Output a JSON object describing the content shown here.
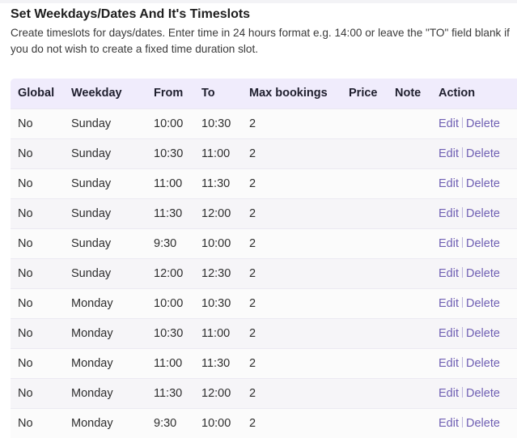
{
  "header": {
    "title": "Set Weekdays/Dates And It's Timeslots",
    "description": "Create timeslots for days/dates. Enter time in 24 hours format e.g. 14:00 or leave the \"TO\" field blank if you do not wish to create a fixed time duration slot."
  },
  "table": {
    "columns": [
      "Global",
      "Weekday",
      "From",
      "To",
      "Max bookings",
      "Price",
      "Note",
      "Action"
    ],
    "edit_label": "Edit",
    "delete_label": "Delete",
    "rows": [
      {
        "global": "No",
        "weekday": "Sunday",
        "from": "10:00",
        "to": "10:30",
        "max": "2",
        "price": "",
        "note": ""
      },
      {
        "global": "No",
        "weekday": "Sunday",
        "from": "10:30",
        "to": "11:00",
        "max": "2",
        "price": "",
        "note": ""
      },
      {
        "global": "No",
        "weekday": "Sunday",
        "from": "11:00",
        "to": "11:30",
        "max": "2",
        "price": "",
        "note": ""
      },
      {
        "global": "No",
        "weekday": "Sunday",
        "from": "11:30",
        "to": "12:00",
        "max": "2",
        "price": "",
        "note": ""
      },
      {
        "global": "No",
        "weekday": "Sunday",
        "from": "9:30",
        "to": "10:00",
        "max": "2",
        "price": "",
        "note": ""
      },
      {
        "global": "No",
        "weekday": "Sunday",
        "from": "12:00",
        "to": "12:30",
        "max": "2",
        "price": "",
        "note": ""
      },
      {
        "global": "No",
        "weekday": "Monday",
        "from": "10:00",
        "to": "10:30",
        "max": "2",
        "price": "",
        "note": ""
      },
      {
        "global": "No",
        "weekday": "Monday",
        "from": "10:30",
        "to": "11:00",
        "max": "2",
        "price": "",
        "note": ""
      },
      {
        "global": "No",
        "weekday": "Monday",
        "from": "11:00",
        "to": "11:30",
        "max": "2",
        "price": "",
        "note": ""
      },
      {
        "global": "No",
        "weekday": "Monday",
        "from": "11:30",
        "to": "12:00",
        "max": "2",
        "price": "",
        "note": ""
      },
      {
        "global": "No",
        "weekday": "Monday",
        "from": "9:30",
        "to": "10:00",
        "max": "2",
        "price": "",
        "note": ""
      }
    ]
  },
  "colors": {
    "accent": "#6f5fb3",
    "header_bg": "#f0ecfc"
  }
}
